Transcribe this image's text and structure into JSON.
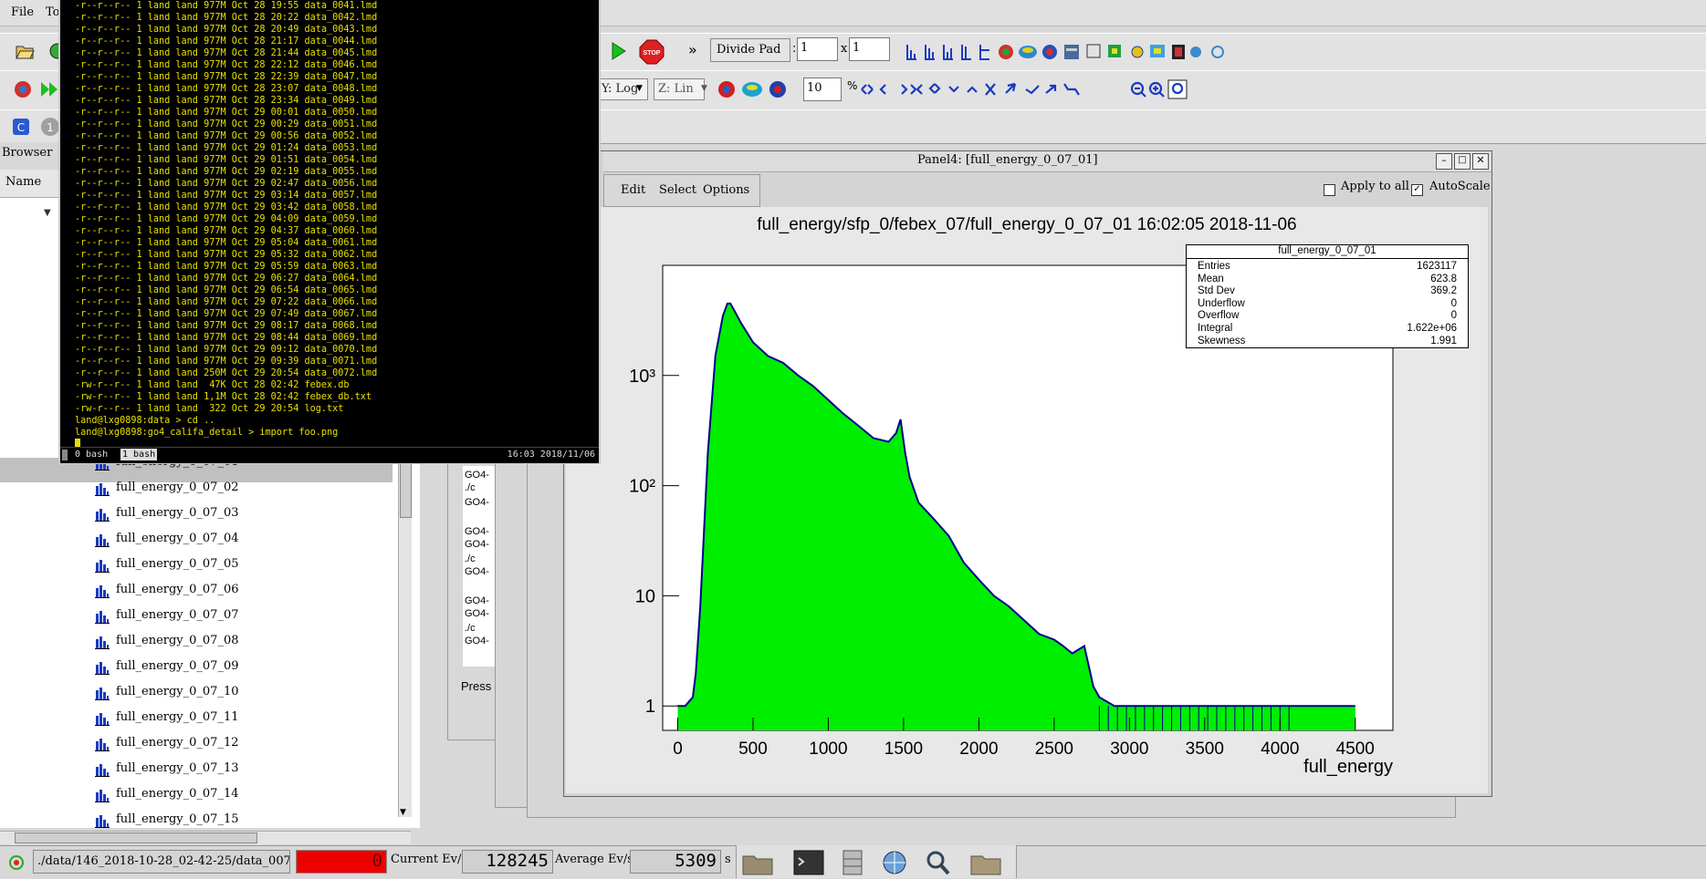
{
  "menubar": {
    "file": "File",
    "tools": "To"
  },
  "toolbar": {
    "divide_pad_label": "Divide Pad",
    "divide_x_value": "1",
    "divide_x_sep": "x",
    "divide_y_value": "1",
    "y_scale": "Y: Log",
    "z_scale": "Z: Lin",
    "percent_value": "10",
    "percent_sign": "%",
    "more": "»",
    "stop_label": "STOP"
  },
  "browser": {
    "title": "Browser",
    "name_header": "Name",
    "items": [
      "full_energy_0_07_01",
      "full_energy_0_07_02",
      "full_energy_0_07_03",
      "full_energy_0_07_04",
      "full_energy_0_07_05",
      "full_energy_0_07_06",
      "full_energy_0_07_07",
      "full_energy_0_07_08",
      "full_energy_0_07_09",
      "full_energy_0_07_10",
      "full_energy_0_07_11",
      "full_energy_0_07_12",
      "full_energy_0_07_13",
      "full_energy_0_07_14",
      "full_energy_0_07_15"
    ]
  },
  "terminal": {
    "lines": [
      "-r--r--r-- 1 land land 977M Oct 28 19:55 data_0041.lmd",
      "-r--r--r-- 1 land land 977M Oct 28 20:22 data_0042.lmd",
      "-r--r--r-- 1 land land 977M Oct 28 20:49 data_0043.lmd",
      "-r--r--r-- 1 land land 977M Oct 28 21:17 data_0044.lmd",
      "-r--r--r-- 1 land land 977M Oct 28 21:44 data_0045.lmd",
      "-r--r--r-- 1 land land 977M Oct 28 22:12 data_0046.lmd",
      "-r--r--r-- 1 land land 977M Oct 28 22:39 data_0047.lmd",
      "-r--r--r-- 1 land land 977M Oct 28 23:07 data_0048.lmd",
      "-r--r--r-- 1 land land 977M Oct 28 23:34 data_0049.lmd",
      "-r--r--r-- 1 land land 977M Oct 29 00:01 data_0050.lmd",
      "-r--r--r-- 1 land land 977M Oct 29 00:29 data_0051.lmd",
      "-r--r--r-- 1 land land 977M Oct 29 00:56 data_0052.lmd",
      "-r--r--r-- 1 land land 977M Oct 29 01:24 data_0053.lmd",
      "-r--r--r-- 1 land land 977M Oct 29 01:51 data_0054.lmd",
      "-r--r--r-- 1 land land 977M Oct 29 02:19 data_0055.lmd",
      "-r--r--r-- 1 land land 977M Oct 29 02:47 data_0056.lmd",
      "-r--r--r-- 1 land land 977M Oct 29 03:14 data_0057.lmd",
      "-r--r--r-- 1 land land 977M Oct 29 03:42 data_0058.lmd",
      "-r--r--r-- 1 land land 977M Oct 29 04:09 data_0059.lmd",
      "-r--r--r-- 1 land land 977M Oct 29 04:37 data_0060.lmd",
      "-r--r--r-- 1 land land 977M Oct 29 05:04 data_0061.lmd",
      "-r--r--r-- 1 land land 977M Oct 29 05:32 data_0062.lmd",
      "-r--r--r-- 1 land land 977M Oct 29 05:59 data_0063.lmd",
      "-r--r--r-- 1 land land 977M Oct 29 06:27 data_0064.lmd",
      "-r--r--r-- 1 land land 977M Oct 29 06:54 data_0065.lmd",
      "-r--r--r-- 1 land land 977M Oct 29 07:22 data_0066.lmd",
      "-r--r--r-- 1 land land 977M Oct 29 07:49 data_0067.lmd",
      "-r--r--r-- 1 land land 977M Oct 29 08:17 data_0068.lmd",
      "-r--r--r-- 1 land land 977M Oct 29 08:44 data_0069.lmd",
      "-r--r--r-- 1 land land 977M Oct 29 09:12 data_0070.lmd",
      "-r--r--r-- 1 land land 977M Oct 29 09:39 data_0071.lmd",
      "-r--r--r-- 1 land land 250M Oct 29 20:54 data_0072.lmd",
      "-rw-r--r-- 1 land land  47K Oct 28 02:42 febex.db",
      "-rw-r--r-- 1 land land 1,1M Oct 28 02:42 febex_db.txt",
      "-rw-r--r-- 1 land land  322 Oct 29 20:54 log.txt",
      "land@lxg0898:data > cd ..",
      "land@lxg0898:go4_califa_detail > import foo.png"
    ],
    "tab0": "0 bash",
    "tab1": "1 bash",
    "clock": "16:03 2018/11/06"
  },
  "log_snippets": [
    "GO4-",
    "./c",
    "GO4-",
    "GO4-",
    "GO4-",
    "./c",
    "GO4-",
    "GO4-",
    "GO4-",
    "./c",
    "GO4-"
  ],
  "press_label": "Press",
  "panel": {
    "title": "Panel4: [full_energy_0_07_01]",
    "menu_edit": "Edit",
    "menu_select": "Select",
    "menu_options": "Options",
    "apply_to_all": "Apply to all",
    "autoscale": "AutoScale",
    "hist_title": "full_energy/sfp_0/febex_07/full_energy_0_07_01  16:02:05  2018-11-06"
  },
  "stats": {
    "name": "full_energy_0_07_01",
    "rows": [
      {
        "k": "Entries",
        "v": "1623117"
      },
      {
        "k": "Mean",
        "v": "623.8"
      },
      {
        "k": "Std Dev",
        "v": "369.2"
      },
      {
        "k": "Underflow",
        "v": "0"
      },
      {
        "k": "Overflow",
        "v": "0"
      },
      {
        "k": "Integral",
        "v": "1.622e+06"
      },
      {
        "k": "Skewness",
        "v": "1.991"
      }
    ]
  },
  "statusbar": {
    "file_path": "./data/146_2018-10-28_02-42-25/data_0072.lmd",
    "red_counter": "0",
    "current_label": "Current Ev/s",
    "current_value": "128245",
    "average_label": "Average Ev/s",
    "average_value": "5309",
    "unit": "s"
  },
  "colors": {
    "fill": "#00ee00",
    "line": "#00008b",
    "terminal_text": "#e8e000",
    "red_field": "#ee0000"
  },
  "chart_data": {
    "type": "area",
    "title": "full_energy/sfp_0/febex_07/full_energy_0_07_01  16:02:05  2018-11-06",
    "xlabel": "full_energy",
    "ylabel": "",
    "log_y": true,
    "xlim": [
      -100,
      4750
    ],
    "ylim": [
      0.6,
      10000
    ],
    "x_ticks": [
      "0",
      "500",
      "1000",
      "1500",
      "2000",
      "2500",
      "3000",
      "3500",
      "4000",
      "4500"
    ],
    "y_ticks": [
      "1",
      "10",
      "10²",
      "10³"
    ],
    "x": [
      0,
      50,
      100,
      120,
      150,
      200,
      250,
      300,
      330,
      350,
      380,
      420,
      500,
      600,
      700,
      800,
      900,
      1000,
      1100,
      1200,
      1300,
      1400,
      1450,
      1480,
      1510,
      1540,
      1600,
      1700,
      1800,
      1900,
      2000,
      2100,
      2200,
      2300,
      2400,
      2500,
      2560,
      2620,
      2700,
      2760,
      2800,
      2900,
      3000,
      3200,
      3500,
      4000,
      4500
    ],
    "y": [
      1,
      1,
      1.2,
      2,
      8,
      200,
      1500,
      3500,
      4500,
      4500,
      3800,
      3000,
      2000,
      1500,
      1300,
      1000,
      800,
      600,
      450,
      350,
      270,
      250,
      300,
      400,
      200,
      120,
      70,
      50,
      35,
      20,
      14,
      10,
      8,
      6,
      4.5,
      4,
      3.5,
      3,
      3.5,
      1.5,
      1.2,
      1,
      1,
      1,
      1,
      1,
      1
    ]
  }
}
